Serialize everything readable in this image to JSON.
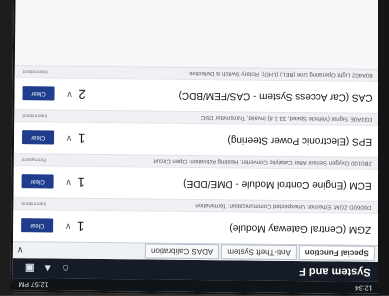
{
  "status_bar": {
    "left_label": "12:34",
    "time": "12:57 PM"
  },
  "title_bar": {
    "title": "System and F",
    "icons": [
      "home-icon",
      "car-icon",
      "menu-icon"
    ]
  },
  "tabs": [
    {
      "label": "Special Function"
    },
    {
      "label": "Anti-Theft System"
    },
    {
      "label": "ADAS Calibration"
    }
  ],
  "modules": [
    {
      "name": "ZGM (Central Gateway Module)",
      "count": "1",
      "button": "Clear",
      "fault": {
        "text": "D0060D ZGM: Ethernet: Unexpected Communication: Termination",
        "status": "Intermittent"
      }
    },
    {
      "name": "ECM (Engine Control Module - DME/DDE)",
      "count": "1",
      "button": "Clear",
      "fault": {
        "text": "2B0100 Oxygen Sensor After Catalytic Converter, Heating Activation: Open Circuit",
        "status": "Permanent"
      }
    },
    {
      "name": "EPS (Electronic Power Steering)",
      "count": "1",
      "button": "Clear",
      "fault": {
        "text": "D33A0E Signal (Vehicle Speed, 33.1.4) Invalid, Transmitter DSC",
        "status": "Intermittent"
      }
    },
    {
      "name": "CAS (Car Access System - CAS/FEM/BDC)",
      "count": "2",
      "button": "Clear",
      "fault": {
        "text": "80A402 Light Operating Unit (BEL) (LHD): Rotary Switch is Defective",
        "status": "Intermittent"
      }
    }
  ],
  "colors": {
    "title_bar": "#161c27",
    "button": "#1f3d8c",
    "screen_bg": "#f7f7f9"
  }
}
